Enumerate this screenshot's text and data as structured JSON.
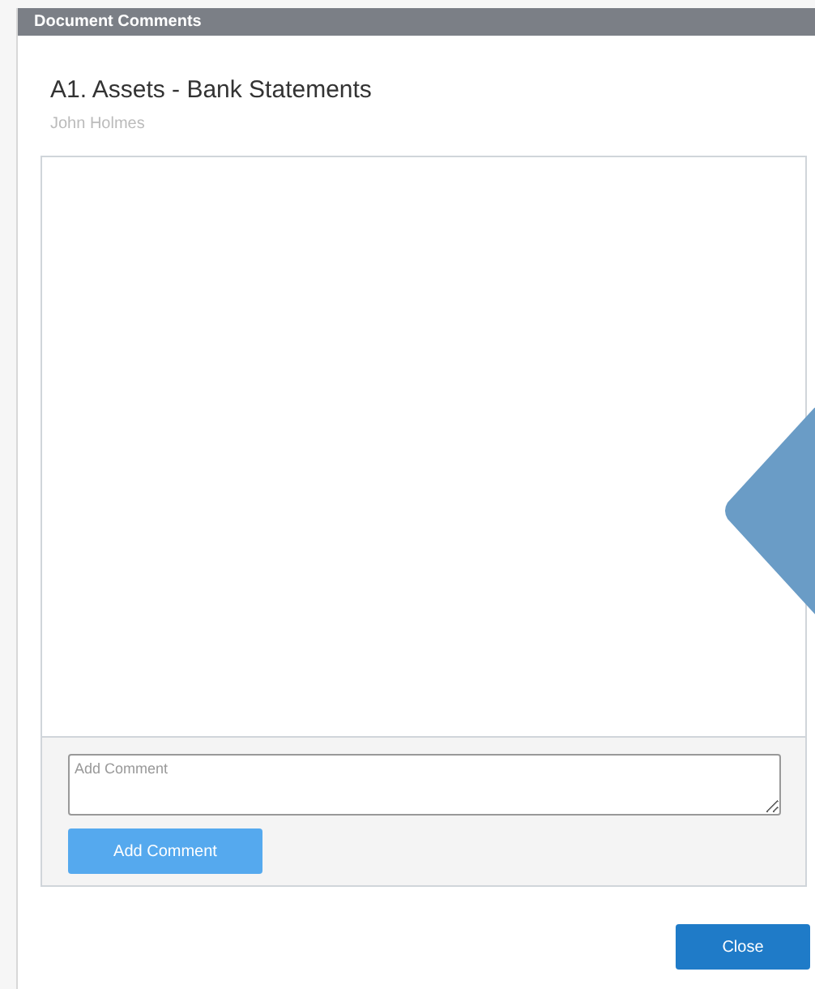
{
  "window": {
    "title": "Document Comments"
  },
  "document": {
    "title": "A1. Assets - Bank Statements",
    "author": "John Holmes"
  },
  "comment_form": {
    "placeholder": "Add Comment",
    "button": "Add Comment"
  },
  "buttons": [
    "Close"
  ]
}
